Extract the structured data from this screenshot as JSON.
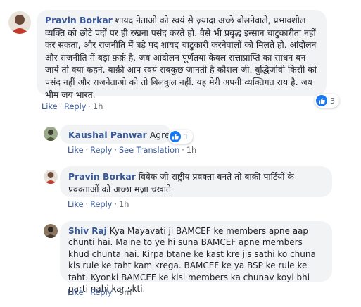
{
  "comments": [
    {
      "author": "Pravin Borkar",
      "text": "शायद नेताओ को स्वयं से ज़्यादा अच्छे बोलनेवाले, प्रभावशील व्यक्ति को छोटे पदों पर ही रखना पसंद करते हो. वैसे भी प्रबुद्ध इन्सान चाटुकारीता नहीं कर सकता, और राजनीति में बड़े पद शायद चाटुकारी करनेवालों को मिलते हो. आंदोलन और राजनीति में बड़ा फ़र्क़ है. जब आंदोलन पूर्णतया केवल सत्ताप्राप्ति का साधन बन जायें तो क्या कहने. बाक़ी आप स्वयं सबकुछ जानती है कौशल जी. बुद्धिजीवी किसी को पसंद नहीं और राजनेताओ को तो बिलकुल नहीं. यह मेरी अपनी व्यक्तिगत राय है. जय भीम जय भारत.",
      "like": "Like",
      "reply": "Reply",
      "time": "1h",
      "reaction_count": "3",
      "reaction_icon": "like-thumb-icon",
      "avatar_colors": [
        "#c0392b",
        "#e74c3c"
      ]
    },
    {
      "author": "Kaushal Panwar",
      "text": "Agree",
      "like": "Like",
      "reply": "Reply",
      "see_translation": "See Translation",
      "time": "1h",
      "reaction_count": "1",
      "reaction_icon": "like-thumb-icon",
      "avatar_colors": [
        "#7a8a6a",
        "#9aab8a"
      ]
    },
    {
      "author": "Pravin Borkar",
      "text": "विवेक जी राष्ट्रीय प्रवक्ता बनते तो बाक़ी पार्टियों के प्रवक्ताओं को अच्छा मज़ा चखाते",
      "like": "Like",
      "reply": "Reply",
      "time": "1h",
      "avatar_colors": [
        "#c0392b",
        "#e74c3c"
      ]
    },
    {
      "author": "Shiv Raj",
      "text": "Kya Mayavati ji BAMCEF ke members apne aap chunti hai. Maine to ye hi suna BAMCEF apne members khud chunta hai. Kirpa btane ke kast kre jis sathi ko chuna kis rule ke taht kam krega. BAMCEF ke ya BSP ke rule ke taht. Kyonki BAMCEF ke kisi members ka chunav koyi bhi parti nahi kar skti.",
      "like": "Like",
      "reply": "Reply",
      "time": "9m",
      "avatar_colors": [
        "#5b4a3a",
        "#8a7560"
      ]
    }
  ],
  "colors": {
    "link": "#385898",
    "bubble": "#f2f3f5",
    "meta": "#606770",
    "like_blue": "#1877f2"
  }
}
